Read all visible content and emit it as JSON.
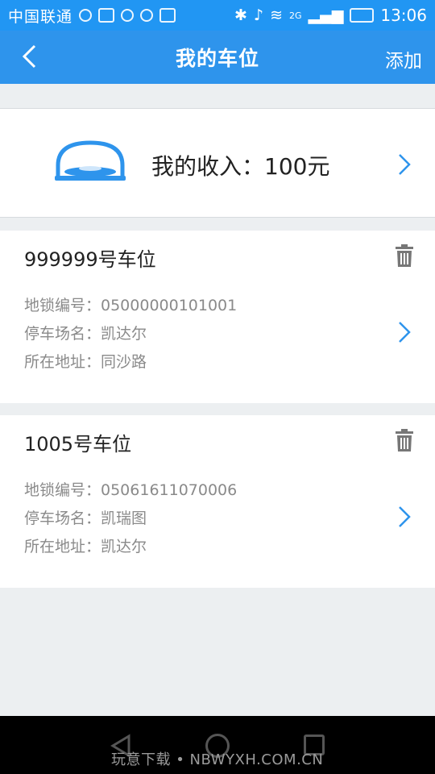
{
  "status_bar": {
    "carrier": "中国联通",
    "time": "13:06",
    "network": "2G"
  },
  "app_bar": {
    "title": "我的车位",
    "add_label": "添加"
  },
  "income": {
    "text": "我的收入：100元"
  },
  "parking_spots": [
    {
      "title": "999999号车位",
      "lock_number": "地锁编号：05000000101001",
      "parking_lot": "停车场名：凯达尔",
      "address": "所在地址：同沙路"
    },
    {
      "title": "1005号车位",
      "lock_number": "地锁编号：05061611070006",
      "parking_lot": "停车场名：凯瑞图",
      "address": "所在地址：凯达尔"
    }
  ],
  "watermark": "玩意下载 • NBWYXH.COM.CN",
  "colors": {
    "primary": "#2e94ec",
    "chevron": "#2e94ec",
    "text_secondary": "#8a8a8a",
    "background": "#eceff1"
  },
  "icons": {
    "back": "chevron-left-icon",
    "lock": "parking-lock-icon",
    "delete": "trash-icon",
    "next": "chevron-right-icon"
  }
}
